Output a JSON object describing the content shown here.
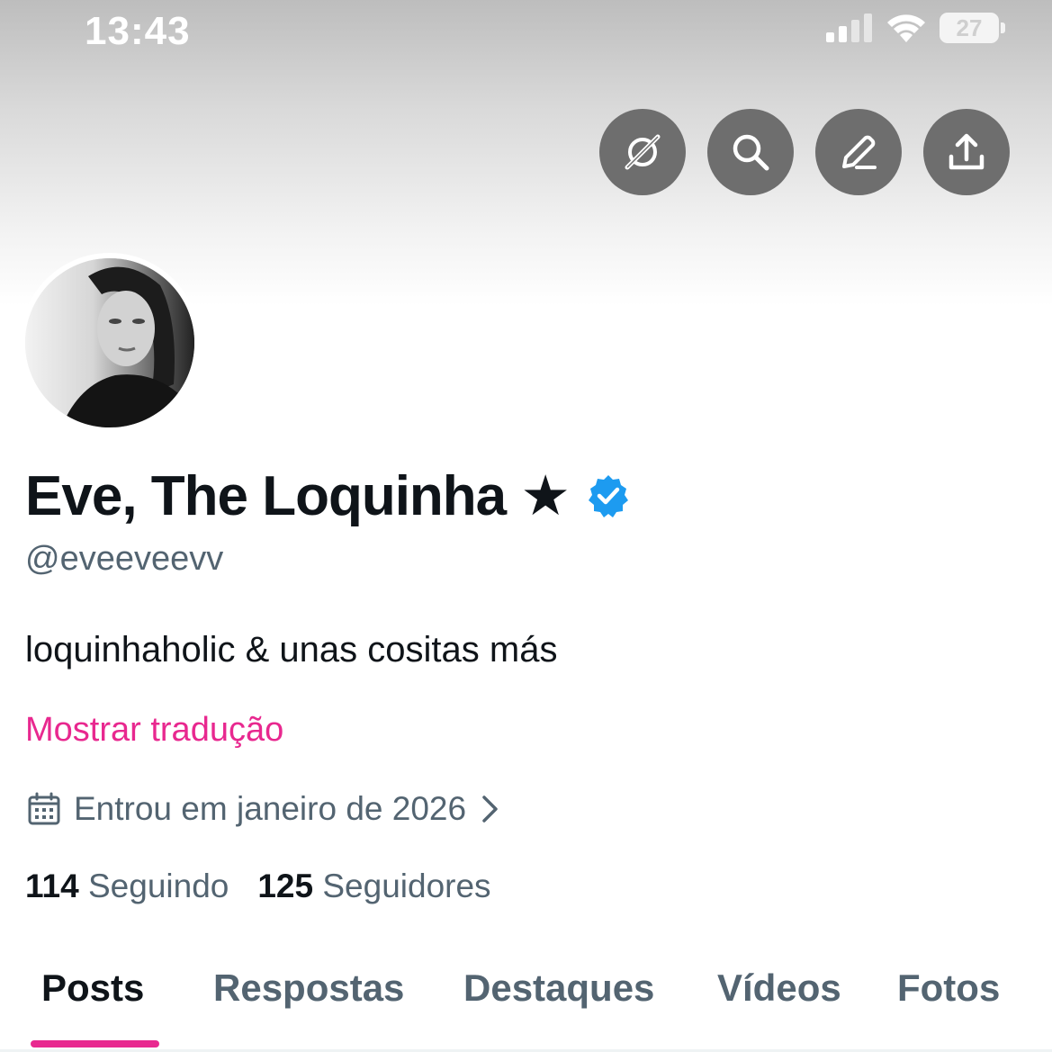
{
  "status_bar": {
    "time": "13:43",
    "battery": "27",
    "icons": [
      "cellular-signal-icon",
      "wifi-icon",
      "battery-icon"
    ]
  },
  "header_actions": [
    {
      "name": "grok-icon"
    },
    {
      "name": "search-icon"
    },
    {
      "name": "edit-icon"
    },
    {
      "name": "share-icon"
    }
  ],
  "profile": {
    "display_name": "Eve, The Loquinha ★",
    "verified": true,
    "handle": "@eveeveevv",
    "bio": "loquinhaholic & unas cositas más",
    "translate_link": "Mostrar tradução",
    "joined": "Entrou em janeiro de 2026",
    "following_count": "114",
    "following_label": "Seguindo",
    "followers_count": "125",
    "followers_label": "Seguidores"
  },
  "tabs": [
    {
      "label": "Posts",
      "active": true
    },
    {
      "label": "Respostas",
      "active": false
    },
    {
      "label": "Destaques",
      "active": false
    },
    {
      "label": "Vídeos",
      "active": false
    },
    {
      "label": "Fotos",
      "active": false
    }
  ],
  "colors": {
    "accent": "#e8288f",
    "verified": "#1d9bf0",
    "text_primary": "#0f1419",
    "text_secondary": "#536471",
    "action_button_bg": "#6e6e6e"
  }
}
